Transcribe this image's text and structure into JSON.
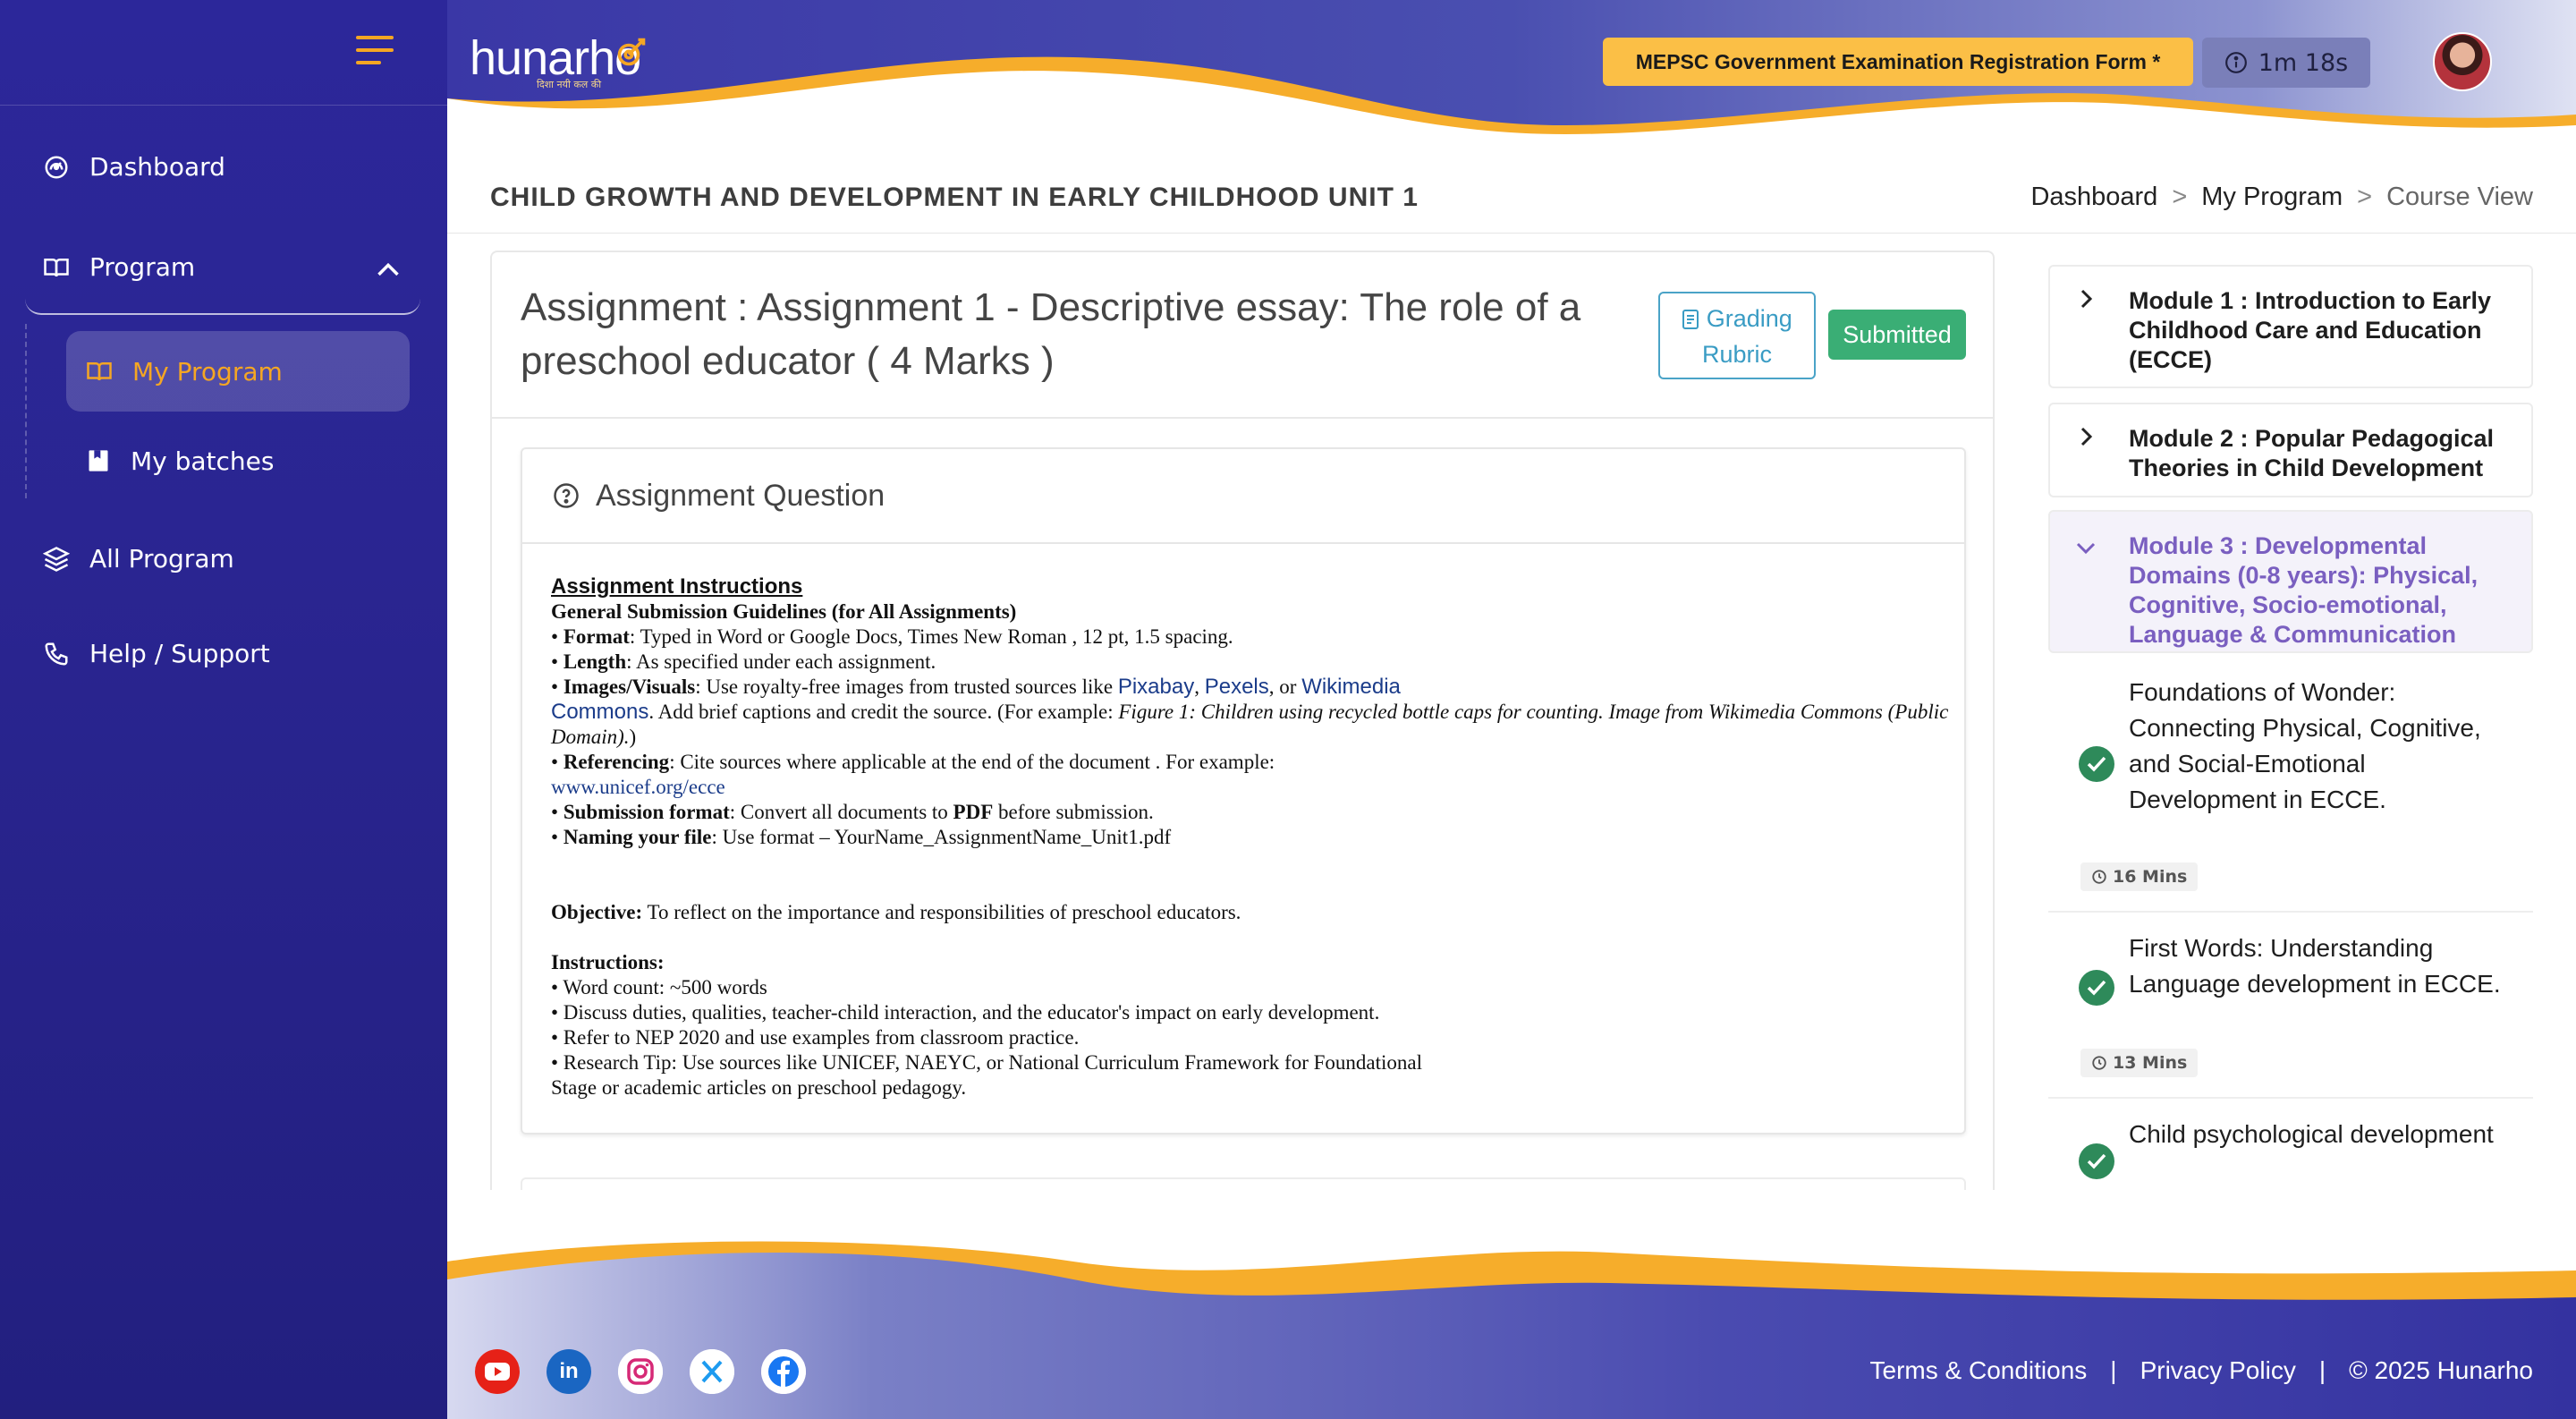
{
  "sidebar": {
    "items": [
      {
        "label": "Dashboard",
        "icon": "dashboard-icon"
      },
      {
        "label": "Program",
        "icon": "book-icon"
      },
      {
        "label": "All Program",
        "icon": "layers-icon"
      },
      {
        "label": "Help / Support",
        "icon": "phone-icon"
      }
    ],
    "sub_items": [
      {
        "label": "My Program",
        "icon": "book-icon",
        "active": true
      },
      {
        "label": "My batches",
        "icon": "bookmark-icon"
      }
    ]
  },
  "header": {
    "logo": "hunarho",
    "logo_tagline": "दिशा नयी कल की",
    "registration_badge": "MEPSC Government Examination Registration Form *",
    "timer": "1m 18s"
  },
  "page": {
    "title": "CHILD GROWTH AND DEVELOPMENT IN EARLY CHILDHOOD UNIT 1",
    "breadcrumb": [
      "Dashboard",
      "My Program",
      "Course View"
    ],
    "breadcrumb_sep": ">"
  },
  "assignment": {
    "title": "Assignment : Assignment 1 - Descriptive essay: The role of a preschool educator ( 4 Marks )",
    "rubric_line1": "Grading",
    "rubric_line2": "Rubric",
    "status": "Submitted",
    "question_heading": "Assignment Question",
    "instructions_heading": "Assignment Instructions",
    "guidelines_heading": "General Submission Guidelines (for All Assignments)",
    "format_label": "Format",
    "format_text": ": Typed in Word or Google Docs, Times New Roman , 12 pt, 1.5 spacing.",
    "length_label": "Length",
    "length_text": ": As specified under each assignment.",
    "images_label": "Images/Visuals",
    "images_text": ": Use royalty-free images from trusted sources like ",
    "link_pixabay": "Pixabay",
    "link_pexels": "Pexels",
    "link_wikimedia": "Wikimedia",
    "link_commons": "Commons",
    "images_text2": ". Add brief captions and credit the source. (For example: ",
    "images_example": "Figure 1: Children using recycled bottle caps for counting. Image from Wikimedia Commons (Public Domain).",
    "images_text3": ")",
    "referencing_label": "Referencing",
    "referencing_text": ": Cite sources where applicable at the end of the document . For example:",
    "referencing_link": "www.unicef.org/ecce",
    "submission_label": "Submission format",
    "submission_text": ": Convert all documents to ",
    "submission_pdf": "PDF",
    "submission_text2": " before submission.",
    "naming_label": "Naming your file",
    "naming_text": ": Use format – YourName_AssignmentName_Unit1.pdf",
    "objective_label": "Objective:",
    "objective_text": " To reflect on the importance and responsibilities of preschool educators.",
    "instructions_label": "Instructions:",
    "bullets": [
      "• Word count: ~500 words",
      "• Discuss duties, qualities, teacher-child interaction, and the educator's impact on early development.",
      "• Refer to NEP 2020 and use examples from classroom practice.",
      "• Research Tip: Use sources like UNICEF, NAEYC, or National Curriculum Framework for Foundational",
      "Stage or academic articles on preschool pedagogy."
    ]
  },
  "modules": [
    {
      "title": "Module 1 : Introduction to Early Childhood Care and Education (ECCE)"
    },
    {
      "title": "Module 2 : Popular Pedagogical Theories in Child Development"
    },
    {
      "title": "Module 3 : Developmental Domains (0-8 years): Physical, Cognitive, Socio-emotional, Language & Communication"
    }
  ],
  "lessons": [
    {
      "title": "Foundations of Wonder: Connecting Physical, Cognitive, and Social-Emotional Development in ECCE.",
      "duration": "16 Mins"
    },
    {
      "title": "First Words: Understanding Language development in ECCE.",
      "duration": "13 Mins"
    },
    {
      "title": "Child psychological development"
    }
  ],
  "footer": {
    "links": [
      "Terms & Conditions",
      "Privacy Policy",
      "© 2025 Hunarho"
    ],
    "separator": "|",
    "social": [
      "youtube-icon",
      "linkedin-icon",
      "instagram-icon",
      "x-icon",
      "facebook-icon"
    ]
  },
  "colors": {
    "sidebar": "#2c279a",
    "accent": "#f5a623",
    "submitted": "#3aae75",
    "module_open": "#7a5fc0",
    "check": "#2e8a5a"
  }
}
